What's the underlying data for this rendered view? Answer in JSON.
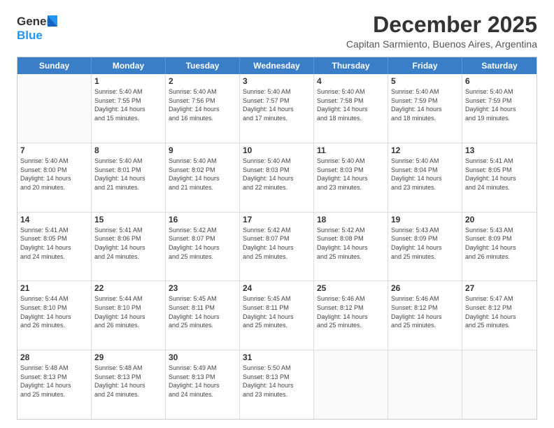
{
  "header": {
    "logo_general": "General",
    "logo_blue": "Blue",
    "main_title": "December 2025",
    "subtitle": "Capitan Sarmiento, Buenos Aires, Argentina"
  },
  "calendar": {
    "days": [
      "Sunday",
      "Monday",
      "Tuesday",
      "Wednesday",
      "Thursday",
      "Friday",
      "Saturday"
    ],
    "rows": [
      [
        {
          "day": "",
          "info": ""
        },
        {
          "day": "1",
          "info": "Sunrise: 5:40 AM\nSunset: 7:55 PM\nDaylight: 14 hours\nand 15 minutes."
        },
        {
          "day": "2",
          "info": "Sunrise: 5:40 AM\nSunset: 7:56 PM\nDaylight: 14 hours\nand 16 minutes."
        },
        {
          "day": "3",
          "info": "Sunrise: 5:40 AM\nSunset: 7:57 PM\nDaylight: 14 hours\nand 17 minutes."
        },
        {
          "day": "4",
          "info": "Sunrise: 5:40 AM\nSunset: 7:58 PM\nDaylight: 14 hours\nand 18 minutes."
        },
        {
          "day": "5",
          "info": "Sunrise: 5:40 AM\nSunset: 7:59 PM\nDaylight: 14 hours\nand 18 minutes."
        },
        {
          "day": "6",
          "info": "Sunrise: 5:40 AM\nSunset: 7:59 PM\nDaylight: 14 hours\nand 19 minutes."
        }
      ],
      [
        {
          "day": "7",
          "info": "Sunrise: 5:40 AM\nSunset: 8:00 PM\nDaylight: 14 hours\nand 20 minutes."
        },
        {
          "day": "8",
          "info": "Sunrise: 5:40 AM\nSunset: 8:01 PM\nDaylight: 14 hours\nand 21 minutes."
        },
        {
          "day": "9",
          "info": "Sunrise: 5:40 AM\nSunset: 8:02 PM\nDaylight: 14 hours\nand 21 minutes."
        },
        {
          "day": "10",
          "info": "Sunrise: 5:40 AM\nSunset: 8:03 PM\nDaylight: 14 hours\nand 22 minutes."
        },
        {
          "day": "11",
          "info": "Sunrise: 5:40 AM\nSunset: 8:03 PM\nDaylight: 14 hours\nand 23 minutes."
        },
        {
          "day": "12",
          "info": "Sunrise: 5:40 AM\nSunset: 8:04 PM\nDaylight: 14 hours\nand 23 minutes."
        },
        {
          "day": "13",
          "info": "Sunrise: 5:41 AM\nSunset: 8:05 PM\nDaylight: 14 hours\nand 24 minutes."
        }
      ],
      [
        {
          "day": "14",
          "info": "Sunrise: 5:41 AM\nSunset: 8:05 PM\nDaylight: 14 hours\nand 24 minutes."
        },
        {
          "day": "15",
          "info": "Sunrise: 5:41 AM\nSunset: 8:06 PM\nDaylight: 14 hours\nand 24 minutes."
        },
        {
          "day": "16",
          "info": "Sunrise: 5:42 AM\nSunset: 8:07 PM\nDaylight: 14 hours\nand 25 minutes."
        },
        {
          "day": "17",
          "info": "Sunrise: 5:42 AM\nSunset: 8:07 PM\nDaylight: 14 hours\nand 25 minutes."
        },
        {
          "day": "18",
          "info": "Sunrise: 5:42 AM\nSunset: 8:08 PM\nDaylight: 14 hours\nand 25 minutes."
        },
        {
          "day": "19",
          "info": "Sunrise: 5:43 AM\nSunset: 8:09 PM\nDaylight: 14 hours\nand 25 minutes."
        },
        {
          "day": "20",
          "info": "Sunrise: 5:43 AM\nSunset: 8:09 PM\nDaylight: 14 hours\nand 26 minutes."
        }
      ],
      [
        {
          "day": "21",
          "info": "Sunrise: 5:44 AM\nSunset: 8:10 PM\nDaylight: 14 hours\nand 26 minutes."
        },
        {
          "day": "22",
          "info": "Sunrise: 5:44 AM\nSunset: 8:10 PM\nDaylight: 14 hours\nand 26 minutes."
        },
        {
          "day": "23",
          "info": "Sunrise: 5:45 AM\nSunset: 8:11 PM\nDaylight: 14 hours\nand 25 minutes."
        },
        {
          "day": "24",
          "info": "Sunrise: 5:45 AM\nSunset: 8:11 PM\nDaylight: 14 hours\nand 25 minutes."
        },
        {
          "day": "25",
          "info": "Sunrise: 5:46 AM\nSunset: 8:12 PM\nDaylight: 14 hours\nand 25 minutes."
        },
        {
          "day": "26",
          "info": "Sunrise: 5:46 AM\nSunset: 8:12 PM\nDaylight: 14 hours\nand 25 minutes."
        },
        {
          "day": "27",
          "info": "Sunrise: 5:47 AM\nSunset: 8:12 PM\nDaylight: 14 hours\nand 25 minutes."
        }
      ],
      [
        {
          "day": "28",
          "info": "Sunrise: 5:48 AM\nSunset: 8:13 PM\nDaylight: 14 hours\nand 25 minutes."
        },
        {
          "day": "29",
          "info": "Sunrise: 5:48 AM\nSunset: 8:13 PM\nDaylight: 14 hours\nand 24 minutes."
        },
        {
          "day": "30",
          "info": "Sunrise: 5:49 AM\nSunset: 8:13 PM\nDaylight: 14 hours\nand 24 minutes."
        },
        {
          "day": "31",
          "info": "Sunrise: 5:50 AM\nSunset: 8:13 PM\nDaylight: 14 hours\nand 23 minutes."
        },
        {
          "day": "",
          "info": ""
        },
        {
          "day": "",
          "info": ""
        },
        {
          "day": "",
          "info": ""
        }
      ]
    ]
  }
}
